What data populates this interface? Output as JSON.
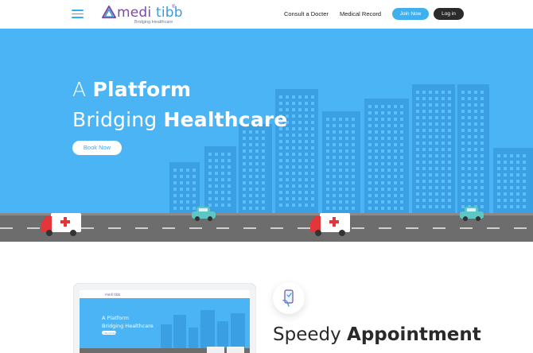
{
  "header": {
    "logo": {
      "brand_first": "medi",
      "brand_second": "tibb",
      "tagline": "Bridging Healthcare"
    },
    "nav": [
      {
        "label": "Consult a Docter"
      },
      {
        "label": "Medical Record"
      }
    ],
    "join_label": "Join Now",
    "login_label": "Log in"
  },
  "hero": {
    "line1_light": "A",
    "line1_bold": "Platform",
    "line2_light": "Bridging",
    "line2_bold": "Healthcare",
    "cta_label": "Book Now"
  },
  "feature": {
    "title_light": "Speedy",
    "title_bold": "Appointment"
  },
  "laptop_preview": {
    "line1": "A Platform",
    "line2": "Bridging Healthcare",
    "cta": "Book Now",
    "brand": "medi tibb"
  },
  "colors": {
    "hero_bg": "#4bb4f5",
    "building": "#3a9fe3",
    "window": "#5bc0fa",
    "road": "#6d6d6d",
    "join": "#3fb0ef",
    "login": "#2b2b2b",
    "logo_purple": "#7b4aa8",
    "logo_blue": "#3a9bd8"
  }
}
